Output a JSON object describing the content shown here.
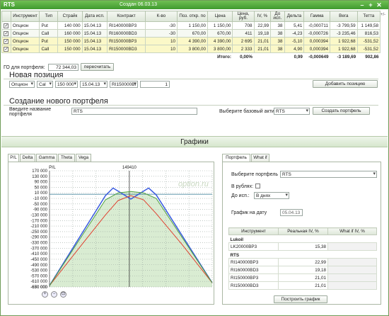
{
  "window": {
    "title": "RTS",
    "created": "Создан 06.03.13"
  },
  "grid": {
    "headers": [
      "",
      "Инструмент",
      "Тип",
      "Страйк",
      "Дата исп.",
      "Контракт",
      "К-во",
      "Поз. откр. по",
      "Цена",
      "Цена, руб.",
      "IV, %",
      "До исп.",
      "Дельта",
      "Гамма",
      "Вега",
      "Тетта"
    ],
    "rows": [
      {
        "instrument": "Опцион",
        "type": "Put",
        "strike": "140 000",
        "date": "15.04.13",
        "contract": "RI140000BP3",
        "qty": "-30",
        "open": "1 150,00",
        "price": "1 150,00",
        "rub": "708",
        "iv": "22,99",
        "days": "38",
        "delta": "5,41",
        "gamma": "-0,000711",
        "vega": "-3 799,59",
        "theta": "1 149,58"
      },
      {
        "instrument": "Опцион",
        "type": "Call",
        "strike": "160 000",
        "date": "15.04.13",
        "contract": "RI160000BD3",
        "qty": "-30",
        "open": "670,00",
        "price": "670,00",
        "rub": "411",
        "iv": "19,18",
        "days": "38",
        "delta": "-4,23",
        "gamma": "-0,000726",
        "vega": "-3 235,46",
        "theta": "816,53"
      },
      {
        "instrument": "Опцион",
        "type": "Put",
        "strike": "150 000",
        "date": "15.04.13",
        "contract": "RI150000BP3",
        "qty": "10",
        "open": "4 390,00",
        "price": "4 390,00",
        "rub": "2 695",
        "iv": "21,01",
        "days": "38",
        "delta": "-5,10",
        "gamma": "0,000394",
        "vega": "1 922,68",
        "theta": "-531,52"
      },
      {
        "instrument": "Опцион",
        "type": "Call",
        "strike": "150 000",
        "date": "15.04.13",
        "contract": "RI150000BD3",
        "qty": "10",
        "open": "3 800,00",
        "price": "3 800,00",
        "rub": "2 333",
        "iv": "21,01",
        "days": "38",
        "delta": "4,90",
        "gamma": "0,000394",
        "vega": "1 922,68",
        "theta": "-531,52"
      }
    ],
    "total": {
      "label": "Итого:",
      "pct": "0,00%",
      "delta": "0,99",
      "gamma": "-0,000649",
      "vega": "-3 189,69",
      "theta": "902,86"
    },
    "plusminus": "+/-"
  },
  "go": {
    "label": "ГО для портфеля:",
    "value": "72 344,03",
    "recalc": "пересчитать"
  },
  "newpos": {
    "title": "Новая позиция",
    "instrument": "Опцион",
    "type": "Cal",
    "strike": "150 000",
    "date": "15.04.13",
    "contract": "RI150000BI",
    "qty": "1",
    "add": "Добавить позицию"
  },
  "create": {
    "title": "Создание нового портфеля",
    "name_label": "Введите название портфеля",
    "name_value": "RTS",
    "asset_label": "Выберите базовый актив",
    "asset_value": "RTS",
    "button": "Создать портфель"
  },
  "graphs": {
    "title": "Графики"
  },
  "tabs": {
    "left": [
      "P/L",
      "Delta",
      "Gamma",
      "Theta",
      "Vega"
    ],
    "right": [
      "Портфель",
      "What if"
    ]
  },
  "chart_data": {
    "type": "line",
    "ylabel": "P/L",
    "marker_label": "149410",
    "watermark": "option.ru",
    "yticks": [
      "170 000",
      "130 000",
      "90 000",
      "50 000",
      "10 000",
      "-10 000",
      "-50 000",
      "-90 000",
      "-130 000",
      "-170 000",
      "-210 000",
      "-250 000",
      "-290 000",
      "-330 000",
      "-370 000",
      "-410 000",
      "-450 000",
      "-490 000",
      "-530 000",
      "-570 000",
      "-610 000",
      "-650 000",
      "-670 000"
    ],
    "ylim": [
      -670000,
      170000
    ],
    "xlim": [
      118000,
      182000
    ],
    "marker_x": 149410,
    "series": [
      {
        "color": "#3a5be0",
        "x": [
          118000,
          140000,
          143000,
          147000,
          150000,
          153000,
          157000,
          160000,
          182000
        ],
        "y": [
          -660000,
          -10000,
          45000,
          0,
          -35000,
          0,
          45000,
          -5000,
          -640000
        ]
      },
      {
        "color": "#e04030",
        "x": [
          118000,
          130000,
          140000,
          145000,
          150000,
          155000,
          160000,
          170000,
          182000
        ],
        "y": [
          -660000,
          -380000,
          -150000,
          -45000,
          -10000,
          -40000,
          -140000,
          -360000,
          -640000
        ]
      },
      {
        "color": "#50a040",
        "x": [
          118000,
          140000,
          145000,
          150000,
          155000,
          160000,
          182000
        ],
        "y": [
          -660000,
          -40000,
          10000,
          20000,
          10000,
          -30000,
          -640000
        ]
      }
    ]
  },
  "right": {
    "portfolio_label": "Выберите портфель",
    "portfolio_value": "RTS",
    "rub_label": "В рублях:",
    "until_label": "До исп.:",
    "until_value": "В днях",
    "date_label": "График на дату",
    "date_value": "05.04.13",
    "table_headers": [
      "Инструмент",
      "Реальная IV, %",
      "What if IV, %"
    ],
    "groups": [
      {
        "name": "Lukoil",
        "rows": [
          {
            "code": "LK20000BP3",
            "iv": "15,38"
          }
        ]
      },
      {
        "name": "RTS",
        "rows": [
          {
            "code": "RI140000BP3",
            "iv": "22,99"
          },
          {
            "code": "RI160000BD3",
            "iv": "19,18"
          },
          {
            "code": "RI150000BP3",
            "iv": "21,01"
          },
          {
            "code": "RI150000BD3",
            "iv": "21,01"
          }
        ]
      }
    ],
    "build": "Построить график"
  }
}
